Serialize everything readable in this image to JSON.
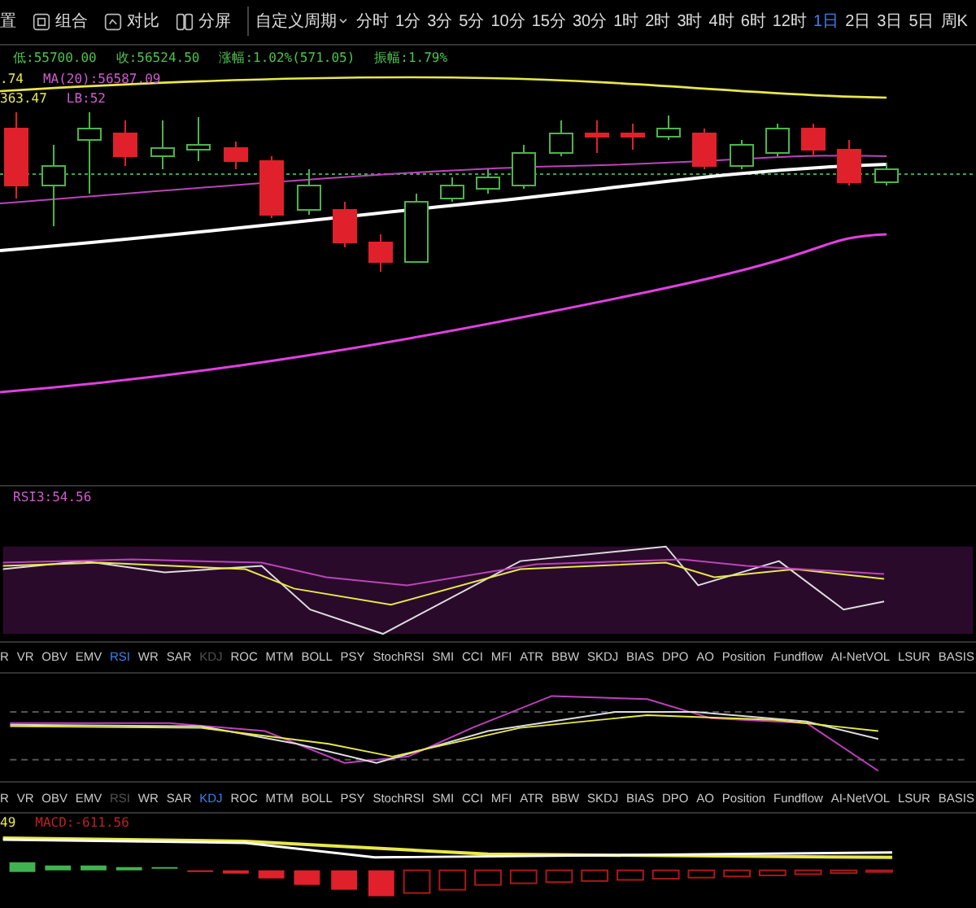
{
  "toolbar": {
    "items": [
      {
        "label": "置"
      },
      {
        "label": "组合"
      },
      {
        "label": "对比"
      },
      {
        "label": "分屏"
      }
    ],
    "custom_period": "自定义周期",
    "periods": [
      {
        "label": "分时",
        "selected": false
      },
      {
        "label": "1分",
        "selected": false
      },
      {
        "label": "3分",
        "selected": false
      },
      {
        "label": "5分",
        "selected": false
      },
      {
        "label": "10分",
        "selected": false
      },
      {
        "label": "15分",
        "selected": false
      },
      {
        "label": "30分",
        "selected": false
      },
      {
        "label": "1时",
        "selected": false
      },
      {
        "label": "2时",
        "selected": false
      },
      {
        "label": "3时",
        "selected": false
      },
      {
        "label": "4时",
        "selected": false
      },
      {
        "label": "6时",
        "selected": false
      },
      {
        "label": "12时",
        "selected": false
      },
      {
        "label": "1日",
        "selected": true
      },
      {
        "label": "2日",
        "selected": false
      },
      {
        "label": "3日",
        "selected": false
      },
      {
        "label": "5日",
        "selected": false
      },
      {
        "label": "周K",
        "selected": false
      }
    ]
  },
  "quote": [
    {
      "text": "低:55700.00",
      "color": "#4ec24e"
    },
    {
      "text": "收:56524.50",
      "color": "#4ec24e"
    },
    {
      "text": "涨幅:1.02%(571.05)",
      "color": "#4ec24e"
    },
    {
      "text": "振幅:1.79%",
      "color": "#4ec24e"
    }
  ],
  "main_legend": [
    {
      "text": ".74",
      "color": "#e8e84a"
    },
    {
      "text": "MA(20):56587.09",
      "color": "#d05cd0"
    },
    {
      "text": "363.47",
      "color": "#e8e84a"
    },
    {
      "text": "LB:52",
      "color": "#d05cd0"
    }
  ],
  "rsi_legend": "RSI3:54.56",
  "indicator_rows": [
    {
      "tabs": [
        {
          "label": "R",
          "selected": false,
          "disabled": false
        },
        {
          "label": "VR",
          "selected": false,
          "disabled": false
        },
        {
          "label": "OBV",
          "selected": false,
          "disabled": false
        },
        {
          "label": "EMV",
          "selected": false,
          "disabled": false
        },
        {
          "label": "RSI",
          "selected": true,
          "disabled": false
        },
        {
          "label": "WR",
          "selected": false,
          "disabled": false
        },
        {
          "label": "SAR",
          "selected": false,
          "disabled": false
        },
        {
          "label": "KDJ",
          "selected": false,
          "disabled": true
        },
        {
          "label": "ROC",
          "selected": false,
          "disabled": false
        },
        {
          "label": "MTM",
          "selected": false,
          "disabled": false
        },
        {
          "label": "BOLL",
          "selected": false,
          "disabled": false
        },
        {
          "label": "PSY",
          "selected": false,
          "disabled": false
        },
        {
          "label": "StochRSI",
          "selected": false,
          "disabled": false
        },
        {
          "label": "SMI",
          "selected": false,
          "disabled": false
        },
        {
          "label": "CCI",
          "selected": false,
          "disabled": false
        },
        {
          "label": "MFI",
          "selected": false,
          "disabled": false
        },
        {
          "label": "ATR",
          "selected": false,
          "disabled": false
        },
        {
          "label": "BBW",
          "selected": false,
          "disabled": false
        },
        {
          "label": "SKDJ",
          "selected": false,
          "disabled": false
        },
        {
          "label": "BIAS",
          "selected": false,
          "disabled": false
        },
        {
          "label": "DPO",
          "selected": false,
          "disabled": false
        },
        {
          "label": "AO",
          "selected": false,
          "disabled": false
        },
        {
          "label": "Position",
          "selected": false,
          "disabled": false
        },
        {
          "label": "Fundflow",
          "selected": false,
          "disabled": false
        },
        {
          "label": "AI-NetVOL",
          "selected": false,
          "disabled": false
        },
        {
          "label": "LSUR",
          "selected": false,
          "disabled": false
        },
        {
          "label": "BASIS",
          "selected": false,
          "disabled": false
        }
      ]
    },
    {
      "tabs": [
        {
          "label": "R",
          "selected": false,
          "disabled": false
        },
        {
          "label": "VR",
          "selected": false,
          "disabled": false
        },
        {
          "label": "OBV",
          "selected": false,
          "disabled": false
        },
        {
          "label": "EMV",
          "selected": false,
          "disabled": false
        },
        {
          "label": "RSI",
          "selected": false,
          "disabled": true
        },
        {
          "label": "WR",
          "selected": false,
          "disabled": false
        },
        {
          "label": "SAR",
          "selected": false,
          "disabled": false
        },
        {
          "label": "KDJ",
          "selected": true,
          "disabled": false
        },
        {
          "label": "ROC",
          "selected": false,
          "disabled": false
        },
        {
          "label": "MTM",
          "selected": false,
          "disabled": false
        },
        {
          "label": "BOLL",
          "selected": false,
          "disabled": false
        },
        {
          "label": "PSY",
          "selected": false,
          "disabled": false
        },
        {
          "label": "StochRSI",
          "selected": false,
          "disabled": false
        },
        {
          "label": "SMI",
          "selected": false,
          "disabled": false
        },
        {
          "label": "CCI",
          "selected": false,
          "disabled": false
        },
        {
          "label": "MFI",
          "selected": false,
          "disabled": false
        },
        {
          "label": "ATR",
          "selected": false,
          "disabled": false
        },
        {
          "label": "BBW",
          "selected": false,
          "disabled": false
        },
        {
          "label": "SKDJ",
          "selected": false,
          "disabled": false
        },
        {
          "label": "BIAS",
          "selected": false,
          "disabled": false
        },
        {
          "label": "DPO",
          "selected": false,
          "disabled": false
        },
        {
          "label": "AO",
          "selected": false,
          "disabled": false
        },
        {
          "label": "Position",
          "selected": false,
          "disabled": false
        },
        {
          "label": "Fundflow",
          "selected": false,
          "disabled": false
        },
        {
          "label": "AI-NetVOL",
          "selected": false,
          "disabled": false
        },
        {
          "label": "LSUR",
          "selected": false,
          "disabled": false
        },
        {
          "label": "BASIS",
          "selected": false,
          "disabled": false
        }
      ]
    }
  ],
  "macd_legend": [
    {
      "text": "49",
      "color": "#e8e84a"
    },
    {
      "text": "MACD:-611.56",
      "color": "#c02020"
    }
  ]
}
